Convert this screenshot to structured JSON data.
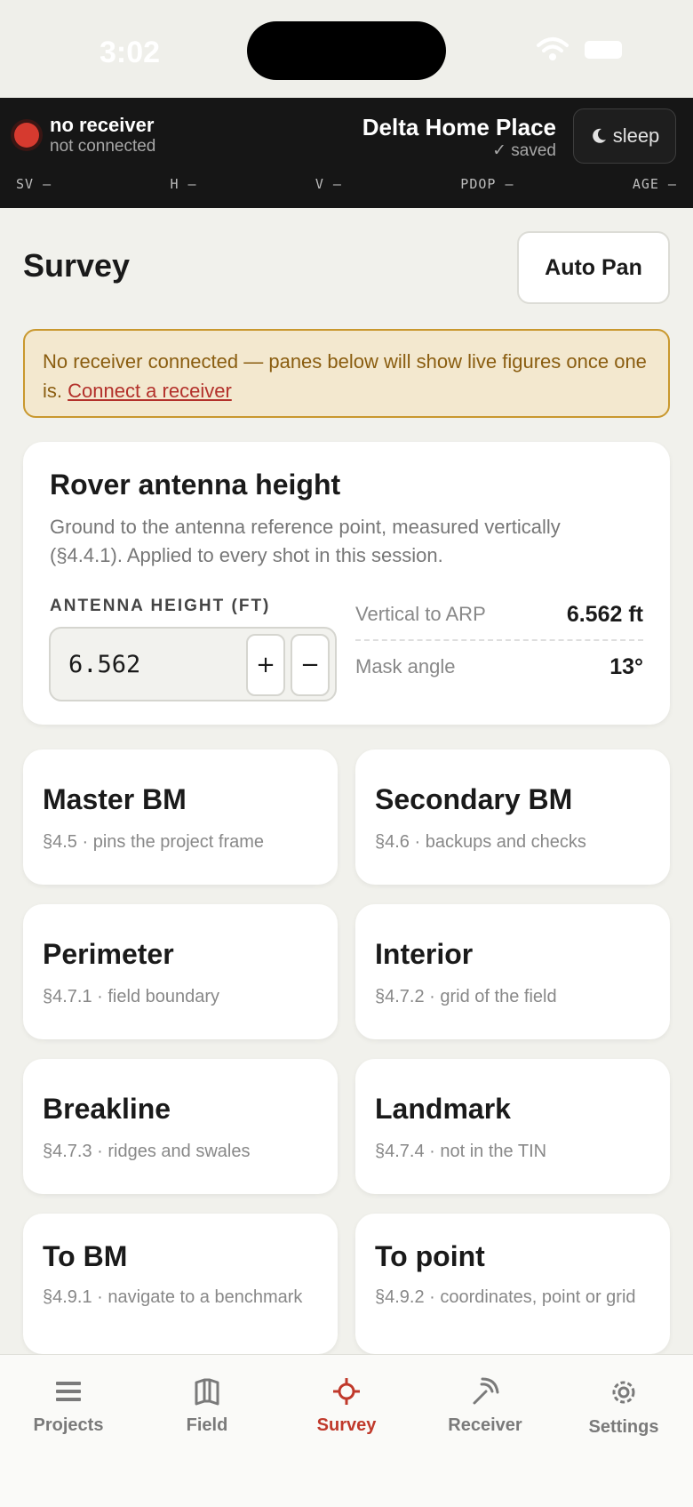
{
  "status_bar": {
    "time": "3:02"
  },
  "receiver": {
    "name": "no receiver",
    "status": "not connected",
    "project_name": "Delta Home Place",
    "save_state": "✓ saved",
    "sleep_label": "sleep",
    "metrics": [
      {
        "label": "SV —"
      },
      {
        "label": "H —"
      },
      {
        "label": "V —"
      },
      {
        "label": "PDOP —"
      },
      {
        "label": "AGE —"
      }
    ],
    "dot_color": "#d63a2f"
  },
  "page": {
    "title": "Survey",
    "auto_pan_label": "Auto Pan"
  },
  "warning": {
    "text": "No receiver connected — panes below will show live figures once one is. ",
    "link": "Connect a receiver"
  },
  "antenna": {
    "title": "Rover antenna height",
    "description": "Ground to the antenna reference point, measured vertically (§4.4.1). Applied to every shot in this session.",
    "field_label": "ANTENNA HEIGHT (FT)",
    "value": "6.562",
    "plus": "+",
    "minus": "−",
    "stats": [
      {
        "key": "Vertical to ARP",
        "value": "6.562 ft"
      },
      {
        "key": "Mask angle",
        "value": "13°"
      }
    ]
  },
  "tiles": [
    {
      "title": "Master BM",
      "subtitle": "§4.5 · pins the project frame"
    },
    {
      "title": "Secondary BM",
      "subtitle": "§4.6 · backups and checks"
    },
    {
      "title": "Perimeter",
      "subtitle": "§4.7.1 · field boundary"
    },
    {
      "title": "Interior",
      "subtitle": "§4.7.2 · grid of the field"
    },
    {
      "title": "Breakline",
      "subtitle": "§4.7.3 · ridges and swales"
    },
    {
      "title": "Landmark",
      "subtitle": "§4.7.4 · not in the TIN"
    },
    {
      "title": "To BM",
      "subtitle": "§4.9.1 · navigate to a benchmark"
    },
    {
      "title": "To point",
      "subtitle": "§4.9.2 · coordinates, point or grid"
    }
  ],
  "tabs": [
    {
      "label": "Projects",
      "icon": "list-icon"
    },
    {
      "label": "Field",
      "icon": "map-icon"
    },
    {
      "label": "Survey",
      "icon": "crosshair-icon",
      "active": true
    },
    {
      "label": "Receiver",
      "icon": "antenna-icon"
    },
    {
      "label": "Settings",
      "icon": "gear-icon"
    }
  ],
  "colors": {
    "accent": "#c0392b",
    "warning_bg": "#f3e8cf",
    "warning_border": "#c9982e",
    "header_bg": "#161616"
  }
}
